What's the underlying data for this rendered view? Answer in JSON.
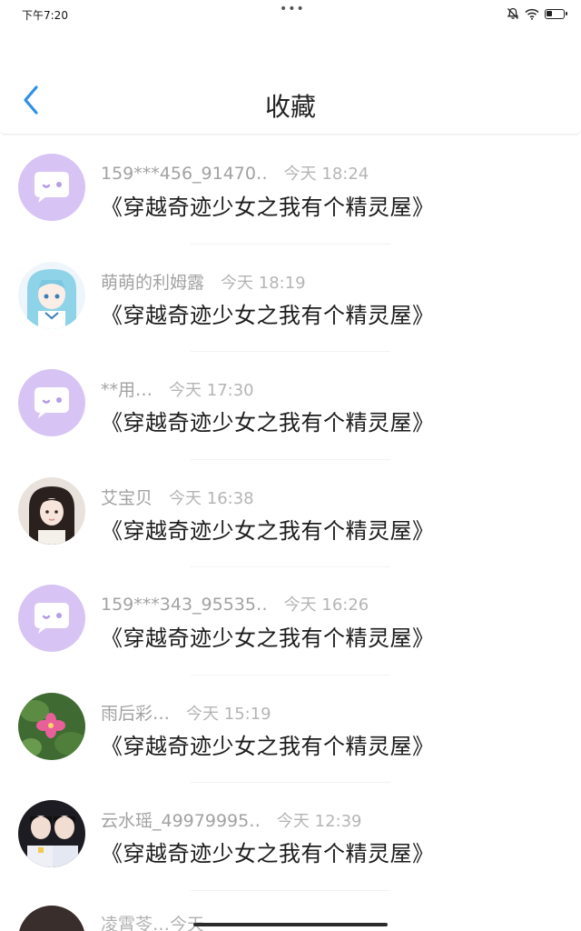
{
  "status": {
    "time": "下午7:20",
    "dots": "•••",
    "battery_level": 0.35
  },
  "header": {
    "title": "收藏"
  },
  "items": [
    {
      "name": "159***456_91470‥",
      "time": "今天 18:24",
      "content": "《穿越奇迹少女之我有个精灵屋》",
      "avatar": "default-chat-avatar"
    },
    {
      "name": "萌萌的利姆露",
      "time": "今天 18:19",
      "content": "《穿越奇迹少女之我有个精灵屋》",
      "avatar": "anime-girl-avatar"
    },
    {
      "name": "**用…",
      "time": "今天 17:30",
      "content": "《穿越奇迹少女之我有个精灵屋》",
      "avatar": "default-chat-avatar"
    },
    {
      "name": "艾宝贝",
      "time": "今天 16:38",
      "content": "《穿越奇迹少女之我有个精灵屋》",
      "avatar": "girl-photo-avatar"
    },
    {
      "name": "159***343_95535‥",
      "time": "今天 16:26",
      "content": "《穿越奇迹少女之我有个精灵屋》",
      "avatar": "default-chat-avatar"
    },
    {
      "name": "雨后彩…",
      "time": "今天 15:19",
      "content": "《穿越奇迹少女之我有个精灵屋》",
      "avatar": "flower-photo-avatar"
    },
    {
      "name": "云水瑶_49979995‥",
      "time": "今天 12:39",
      "content": "《穿越奇迹少女之我有个精灵屋》",
      "avatar": "two-people-photo-avatar"
    }
  ],
  "partial_item": {
    "name": "凌霄苓…今天"
  }
}
